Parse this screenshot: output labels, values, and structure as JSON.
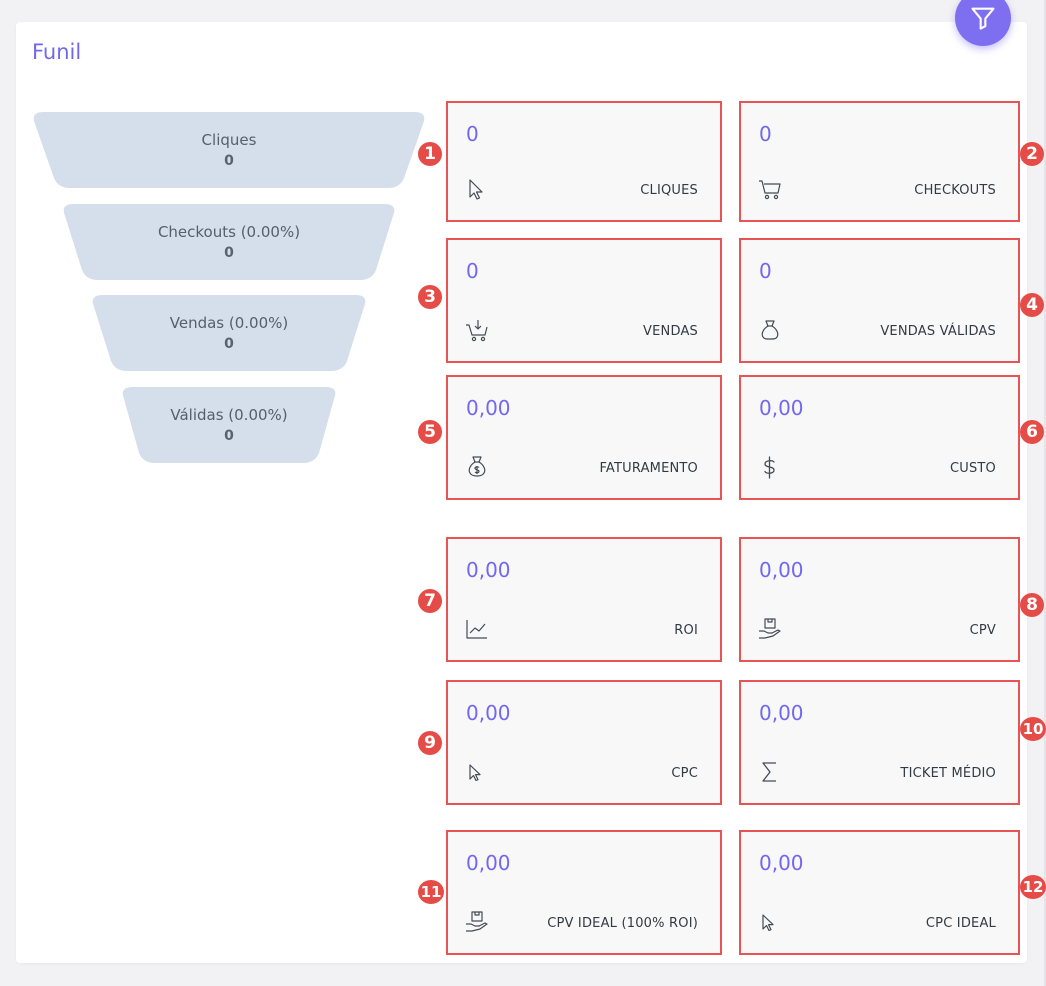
{
  "page": {
    "title": "Funil"
  },
  "filter_button": {
    "icon": "filter-icon",
    "color": "#7e6ff0"
  },
  "funnel": [
    {
      "label": "Cliques",
      "value": "0"
    },
    {
      "label": "Checkouts (0.00%)",
      "value": "0"
    },
    {
      "label": "Vendas (0.00%)",
      "value": "0"
    },
    {
      "label": "Válidas (0.00%)",
      "value": "0"
    }
  ],
  "metrics": [
    {
      "marker": "1",
      "value": "0",
      "label": "CLIQUES",
      "icon": "cursor-icon"
    },
    {
      "marker": "2",
      "value": "0",
      "label": "CHECKOUTS",
      "icon": "cart-icon"
    },
    {
      "marker": "3",
      "value": "0",
      "label": "VENDAS",
      "icon": "cart-download-icon"
    },
    {
      "marker": "4",
      "value": "0",
      "label": "VENDAS VÁLIDAS",
      "icon": "money-bag-icon"
    },
    {
      "marker": "5",
      "value": "0,00",
      "label": "FATURAMENTO",
      "icon": "dollar-bag-icon"
    },
    {
      "marker": "6",
      "value": "0,00",
      "label": "CUSTO",
      "icon": "dollar-icon"
    },
    {
      "marker": "7",
      "value": "0,00",
      "label": "ROI",
      "icon": "line-chart-icon"
    },
    {
      "marker": "8",
      "value": "0,00",
      "label": "CPV",
      "icon": "hand-box-icon"
    },
    {
      "marker": "9",
      "value": "0,00",
      "label": "CPC",
      "icon": "cursor-icon"
    },
    {
      "marker": "10",
      "value": "0,00",
      "label": "TICKET MÉDIO",
      "icon": "sigma-icon"
    },
    {
      "marker": "11",
      "value": "0,00",
      "label": "CPV IDEAL (100% ROI)",
      "icon": "hand-box-icon"
    },
    {
      "marker": "12",
      "value": "0,00",
      "label": "CPC IDEAL",
      "icon": "cursor-icon"
    }
  ],
  "colors": {
    "accent": "#7267ef",
    "card_border": "#e85454",
    "marker": "#e54c48",
    "funnel": "#d5deeb"
  }
}
